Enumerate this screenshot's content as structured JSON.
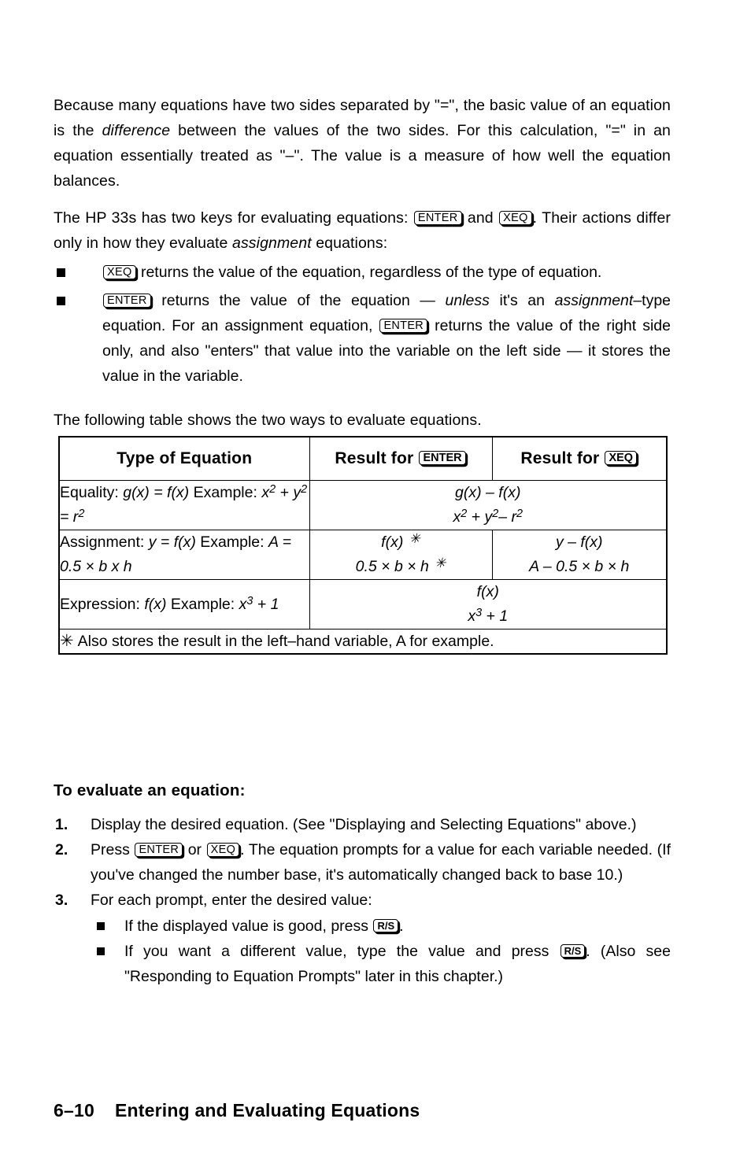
{
  "page": {
    "footer_number": "6–10",
    "footer_title": "Entering and Evaluating Equations"
  },
  "keys": {
    "enter": "ENTER",
    "xeq": "XEQ",
    "rs": "R/S"
  },
  "paragraphs": {
    "intro_1": "Because many equations have two sides separated by \"=\", the basic value of an equation is the ",
    "intro_1_em": "difference",
    "intro_2": " between the values of the two sides. For this calculation, \"=\" in an equation essentially treated as \"–\". The value is a measure of how well the equation balances.",
    "keys_intro_1": "The HP 33s has two keys for evaluating equations: ",
    "keys_intro_and": " and ",
    "keys_intro_2": ".  Their actions differ only in how they evaluate ",
    "keys_intro_em": "assignment",
    "keys_intro_3": " equations:",
    "table_intro": "The following table shows the two ways to evaluate equations."
  },
  "bullets": [
    {
      "key": "XEQ",
      "text": " returns the value of the equation, regardless of the type of equation."
    },
    {
      "key": "ENTER",
      "text_a": " returns the value of the equation — ",
      "em_a": "unless",
      "text_b": " it's an ",
      "em_b": "assignment",
      "text_c": "–type equation. For an assignment equation, ",
      "key_2": "ENTER",
      "text_d": " returns the value of the right side only, and also \"enters\" that value into the variable on the left side — it stores the value in the variable."
    }
  ],
  "table": {
    "headers": {
      "col1": "Type of Equation",
      "col2_prefix": "Result for ",
      "col2_key": "ENTER",
      "col3_prefix": "Result for ",
      "col3_key": "XEQ"
    },
    "rows": [
      {
        "type_label": "Equality: ",
        "type_expr": "g(x) = f(x)",
        "example_label": "Example: ",
        "example_expr_html": "x<sup>2</sup> + y<sup>2</sup> = r<sup>2</sup>",
        "merged": true,
        "result_line1_html": "g(x) – f(x)",
        "result_line2_html": "x<sup>2</sup> + y<sup>2</sup>– r<sup>2</sup>"
      },
      {
        "type_label": "Assignment: ",
        "type_expr": "y = f(x)",
        "example_label": "Example: ",
        "example_expr_html": "A = 0.5 × b x h",
        "merged": false,
        "enter_line1_html": "f(x) <span class=\"ast\">✳</span>",
        "enter_line2_html": "0.5 × b × h <span class=\"ast\">✳</span>",
        "xeq_line1_html": "y – f(x)",
        "xeq_line2_html": "A – 0.5 × b × h"
      },
      {
        "type_label": "Expression: ",
        "type_expr": "f(x)",
        "example_label": "Example: ",
        "example_expr_html": "x<sup>3</sup> + 1",
        "merged": true,
        "result_line1_html": "f(x)",
        "result_line2_html": "x<sup>3</sup> + 1"
      }
    ],
    "footnote_marker": "✳",
    "footnote_text": "Also stores the result in the left–hand variable, A for example."
  },
  "procedure": {
    "heading": "To evaluate an equation:",
    "steps": [
      {
        "number": "1.",
        "text": "Display the desired equation. (See \"Displaying and Selecting Equations\" above.)"
      },
      {
        "number": "2.",
        "text_a": "Press ",
        "key_1": "ENTER",
        "text_b": " or ",
        "key_2": "XEQ",
        "text_c": ". The equation prompts for a value for each variable needed. (If you've changed the number base, it's automatically changed back to base 10.)"
      },
      {
        "number": "3.",
        "text": "For each prompt, enter the desired value:",
        "sub_bullets": [
          {
            "text_a": "If the displayed value is good, press ",
            "key": "R/S",
            "text_b": "."
          },
          {
            "text_a": "If you want a different value, type the value and press ",
            "key": "R/S",
            "text_b": ". (Also see \"Responding to Equation Prompts\" later in this chapter.)"
          }
        ]
      }
    ]
  }
}
